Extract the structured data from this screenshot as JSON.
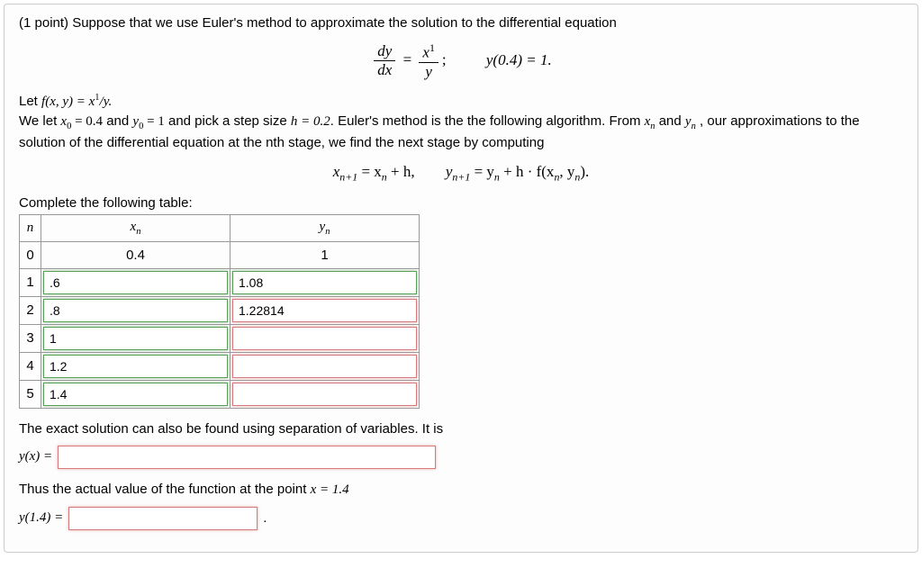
{
  "intro": "(1 point) Suppose that we use Euler's method to approximate the solution to the differential equation",
  "eq": {
    "lhs_num": "dy",
    "lhs_den": "dx",
    "eq_sign": "=",
    "rhs_num_x": "x",
    "rhs_num_sup": "1",
    "rhs_den": "y",
    "semicolon": ";",
    "ic": "y(0.4) = 1."
  },
  "let_line_prefix": "Let ",
  "let_f": "f(x, y) = x",
  "let_f_sup": "1",
  "let_f_tail": "/y.",
  "paragraph1a": "We let ",
  "x0_expr": "x",
  "x0_sub": "0",
  "x0_val": " = 0.4",
  "and1": " and ",
  "y0_expr": "y",
  "y0_sub": "0",
  "y0_val": " = 1",
  "p1_mid": " and pick a step size ",
  "h_expr": "h = 0.2",
  "p1_tail": ". Euler's method is the the following algorithm. From ",
  "xn_expr": "x",
  "n_sub": "n",
  "and2": " and ",
  "yn_expr": "y",
  "p1_end": " , our approximations to the solution of the differential equation at the nth stage, we find the next stage by computing",
  "algo": {
    "x_lhs": "x",
    "np1": "n+1",
    "eq1": " = x",
    "n": "n",
    "plus_h": " + h,",
    "spacer": "        ",
    "y_lhs": "y",
    "eq2": " = y",
    "plus": " + h · f(x",
    "comma_y": ", y",
    "close": ")."
  },
  "table_label": "Complete the following table:",
  "table": {
    "headers": {
      "n": "n",
      "xn": "x",
      "xn_sub": "n",
      "yn": "y",
      "yn_sub": "n"
    },
    "rows": [
      {
        "n": "0",
        "xn_static": "0.4",
        "yn_static": "1"
      },
      {
        "n": "1",
        "xn_input": ".6",
        "xn_state": "correct",
        "yn_input": "1.08",
        "yn_state": "correct"
      },
      {
        "n": "2",
        "xn_input": ".8",
        "xn_state": "correct",
        "yn_input": "1.22814",
        "yn_state": "incorrect"
      },
      {
        "n": "3",
        "xn_input": "1",
        "xn_state": "correct",
        "yn_input": "",
        "yn_state": "incorrect"
      },
      {
        "n": "4",
        "xn_input": "1.2",
        "xn_state": "correct",
        "yn_input": "",
        "yn_state": "incorrect"
      },
      {
        "n": "5",
        "xn_input": "1.4",
        "xn_state": "correct",
        "yn_input": "",
        "yn_state": "incorrect"
      }
    ]
  },
  "exact_text": "The exact solution can also be found using separation of variables. It is",
  "yx_label": "y(x) = ",
  "yx_value": "",
  "actual_text": "Thus the actual value of the function at the point ",
  "x_eq": "x = 1.4",
  "y14_label": "y(1.4) = ",
  "y14_value": "",
  "period": "."
}
